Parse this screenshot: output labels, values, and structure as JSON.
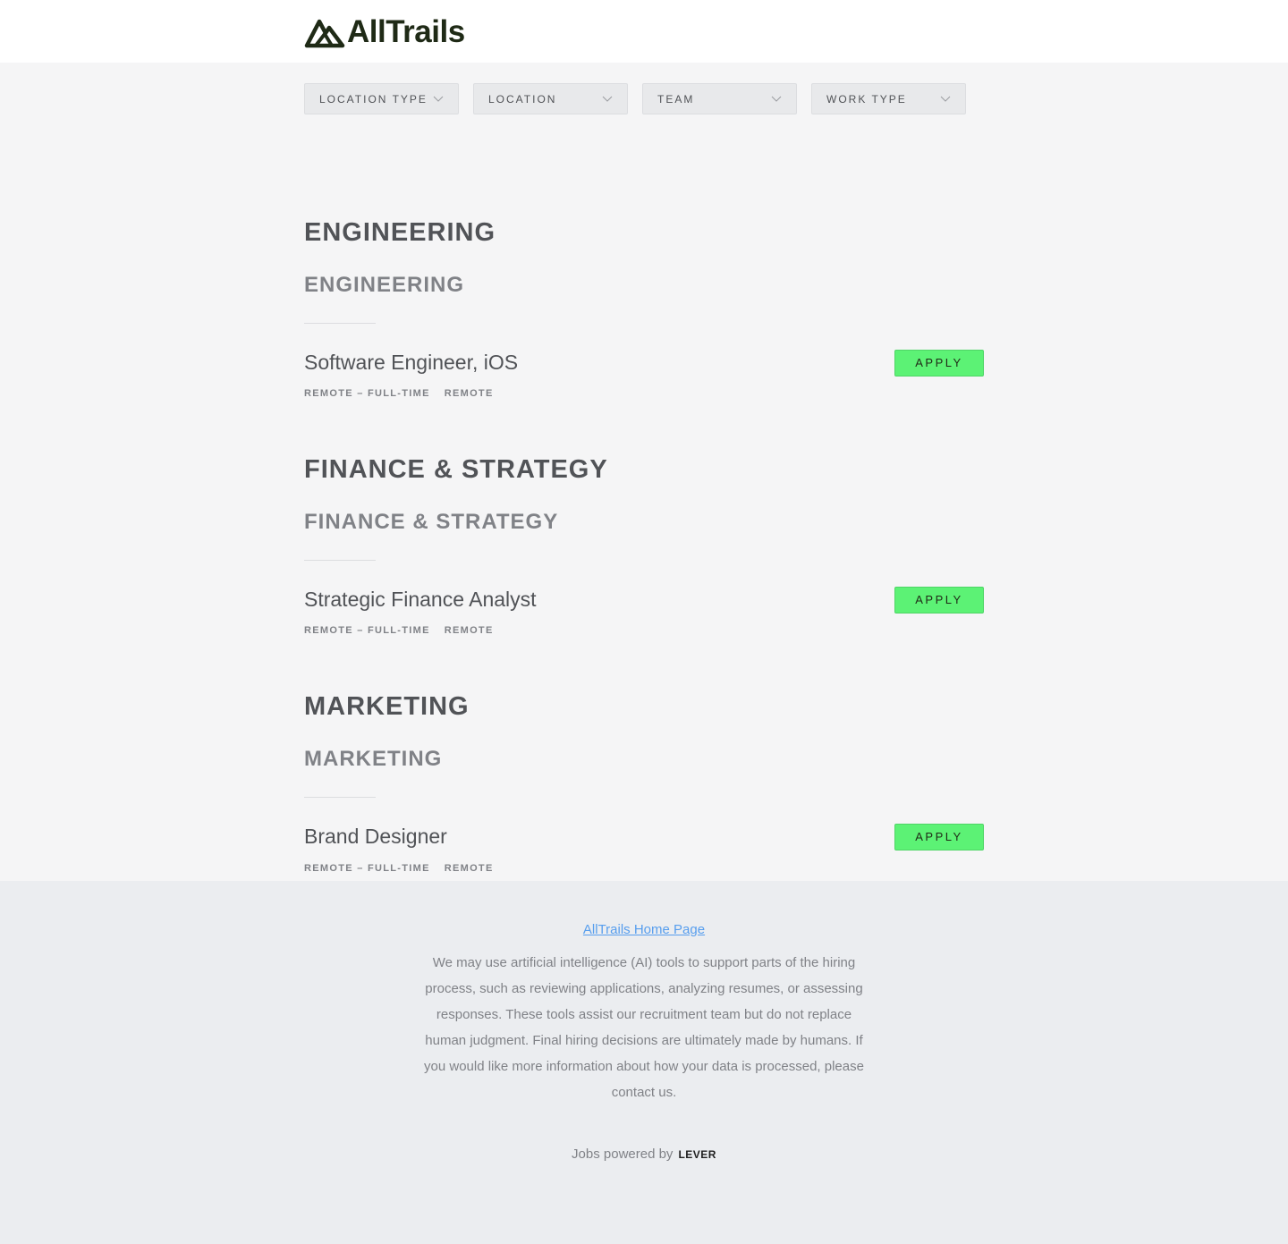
{
  "header": {
    "logo_text": "AllTrails"
  },
  "filters": [
    {
      "label": "LOCATION TYPE"
    },
    {
      "label": "LOCATION"
    },
    {
      "label": "TEAM"
    },
    {
      "label": "WORK TYPE"
    }
  ],
  "groups": [
    {
      "department": "ENGINEERING",
      "team": "ENGINEERING",
      "posting": {
        "title": "Software Engineer, iOS",
        "commitment": "REMOTE – FULL-TIME",
        "location": "REMOTE",
        "apply_label": "APPLY"
      }
    },
    {
      "department": "FINANCE & STRATEGY",
      "team": "FINANCE & STRATEGY",
      "posting": {
        "title": "Strategic Finance Analyst",
        "commitment": "REMOTE – FULL-TIME",
        "location": "REMOTE",
        "apply_label": "APPLY"
      }
    },
    {
      "department": "MARKETING",
      "team": "MARKETING",
      "posting": {
        "title": "Brand Designer",
        "commitment": "REMOTE – FULL-TIME",
        "location": "REMOTE",
        "apply_label": "APPLY"
      }
    }
  ],
  "footer": {
    "home_link": "AllTrails Home Page",
    "ai_notice": "We may use artificial intelligence (AI) tools to support parts of the hiring process, such as reviewing applications, analyzing resumes, or assessing responses. These tools assist our recruitment team but do not replace human judgment. Final hiring decisions are ultimately made by humans. If you would like more information about how your data is processed, please contact us.",
    "powered_by": "Jobs powered by",
    "lever_label": "LEVER"
  },
  "colors": {
    "apply_bg": "#5cf275",
    "link": "#579eee",
    "logo": "#1f2a16"
  }
}
